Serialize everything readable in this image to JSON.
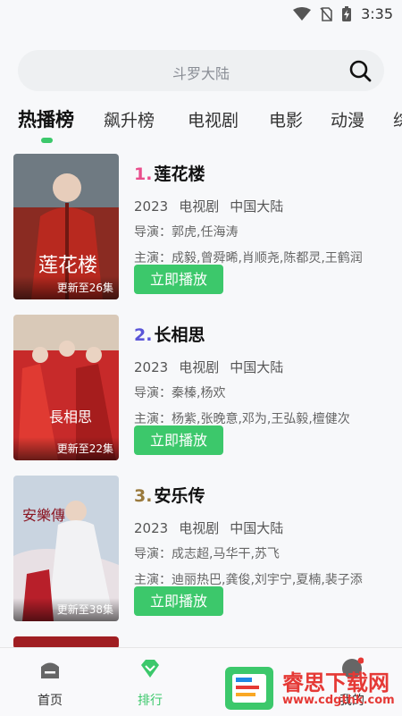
{
  "status": {
    "time": "3:35"
  },
  "search": {
    "placeholder": "斗罗大陆"
  },
  "tabs": [
    "热播榜",
    "飙升榜",
    "电视剧",
    "电影",
    "动漫",
    "综"
  ],
  "items": [
    {
      "rank": "1.",
      "title": "莲花楼",
      "year": "2023",
      "type": "电视剧",
      "region": "中国大陆",
      "director": "导演：郭虎,任海涛",
      "cast": "主演：成毅,曾舜晞,肖顺尧,陈都灵,王鹤润",
      "badge": "更新至26集",
      "button": "立即播放",
      "rank_color": "#e94e8c"
    },
    {
      "rank": "2.",
      "title": "长相思",
      "year": "2023",
      "type": "电视剧",
      "region": "中国大陆",
      "director": "导演：秦榛,杨欢",
      "cast": "主演：杨紫,张晚意,邓为,王弘毅,檀健次",
      "badge": "更新至22集",
      "button": "立即播放",
      "rank_color": "#5a55d8"
    },
    {
      "rank": "3.",
      "title": "安乐传",
      "year": "2023",
      "type": "电视剧",
      "region": "中国大陆",
      "director": "导演：成志超,马华干,苏飞",
      "cast": "主演：迪丽热巴,龚俊,刘宇宁,夏楠,裴子添",
      "badge": "更新至38集",
      "button": "立即播放",
      "rank_color": "#9a7a3d"
    }
  ],
  "nav": {
    "home": "首页",
    "rank": "排行",
    "mine": "我的"
  },
  "watermark": {
    "text": "睿思下载网",
    "url": "www.cdgthk.com"
  },
  "colors": {
    "accent": "#3cc86b"
  }
}
